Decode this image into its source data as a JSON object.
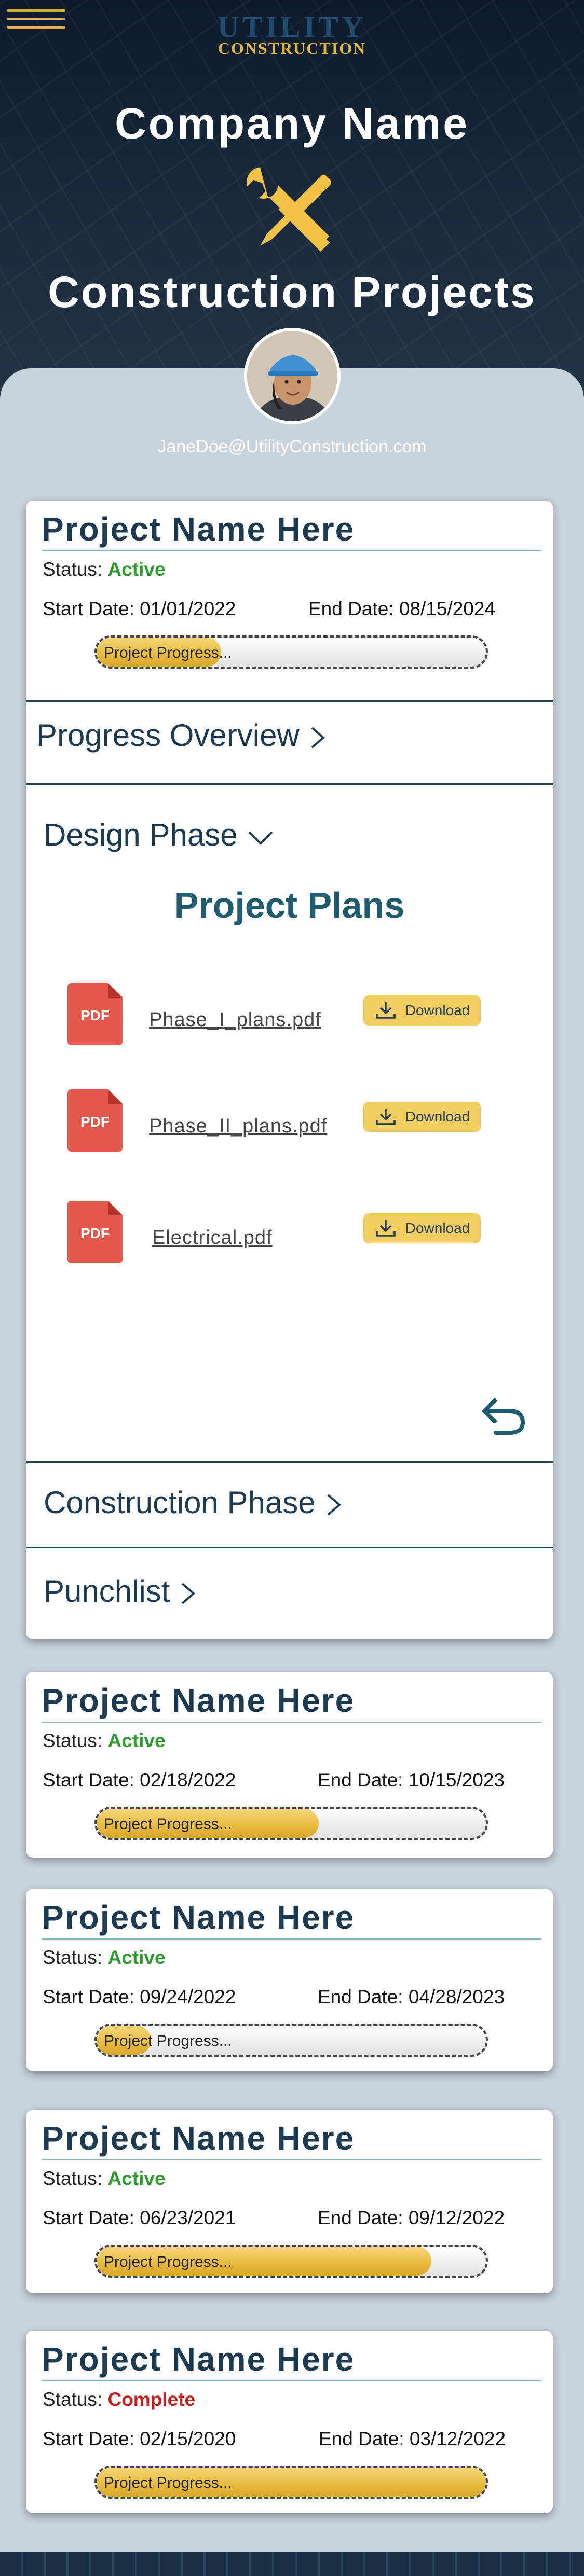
{
  "header": {
    "menu_icon": "hamburger-menu-icon",
    "logo": {
      "top": "UTILITY",
      "bottom": "CONSTRUCTION"
    },
    "company_name": "Company Name",
    "tools_icon": "wrench-screwdriver-icon",
    "page_title": "Construction Projects"
  },
  "user": {
    "avatar": "user-avatar",
    "email": "JaneDoe@UtilityConstruction.com"
  },
  "colors": {
    "accent": "#e8ba3f",
    "navy": "#1d3a53",
    "teal": "#1c5b70",
    "active": "#2f9a2f",
    "complete": "#c62020"
  },
  "common": {
    "status_label": "Status:",
    "start_label": "Start Date:",
    "end_label": "End Date:",
    "progress_label": "Project Progress..."
  },
  "projects": [
    {
      "title": "Project Name Here",
      "status": "Active",
      "start_date": "01/01/2022",
      "end_date": "08/15/2024",
      "progress": 0.32,
      "expanded": true
    },
    {
      "title": "Project Name Here",
      "status": "Active",
      "start_date": "02/18/2022",
      "end_date": "10/15/2023",
      "progress": 0.57
    },
    {
      "title": "Project Name Here",
      "status": "Active",
      "start_date": "09/24/2022",
      "end_date": "04/28/2023",
      "progress": 0.14
    },
    {
      "title": "Project Name Here",
      "status": "Active",
      "start_date": "06/23/2021",
      "end_date": "09/12/2022",
      "progress": 0.86
    },
    {
      "title": "Project Name Here",
      "status": "Complete",
      "start_date": "02/15/2020",
      "end_date": "03/12/2022",
      "progress": 1.0
    }
  ],
  "sections": {
    "progress_overview": "Progress Overview",
    "design_phase": "Design Phase",
    "construction_phase": "Construction Phase",
    "punchlist": "Punchlist"
  },
  "plans": {
    "title": "Project Plans",
    "download_label": "Download",
    "files": [
      {
        "name": "Phase_I_plans.pdf",
        "icon_text": "PDF"
      },
      {
        "name": "Phase_II_plans.pdf",
        "icon_text": "PDF"
      },
      {
        "name": "Electrical.pdf",
        "icon_text": "PDF"
      }
    ],
    "undo_icon": "undo-icon"
  }
}
